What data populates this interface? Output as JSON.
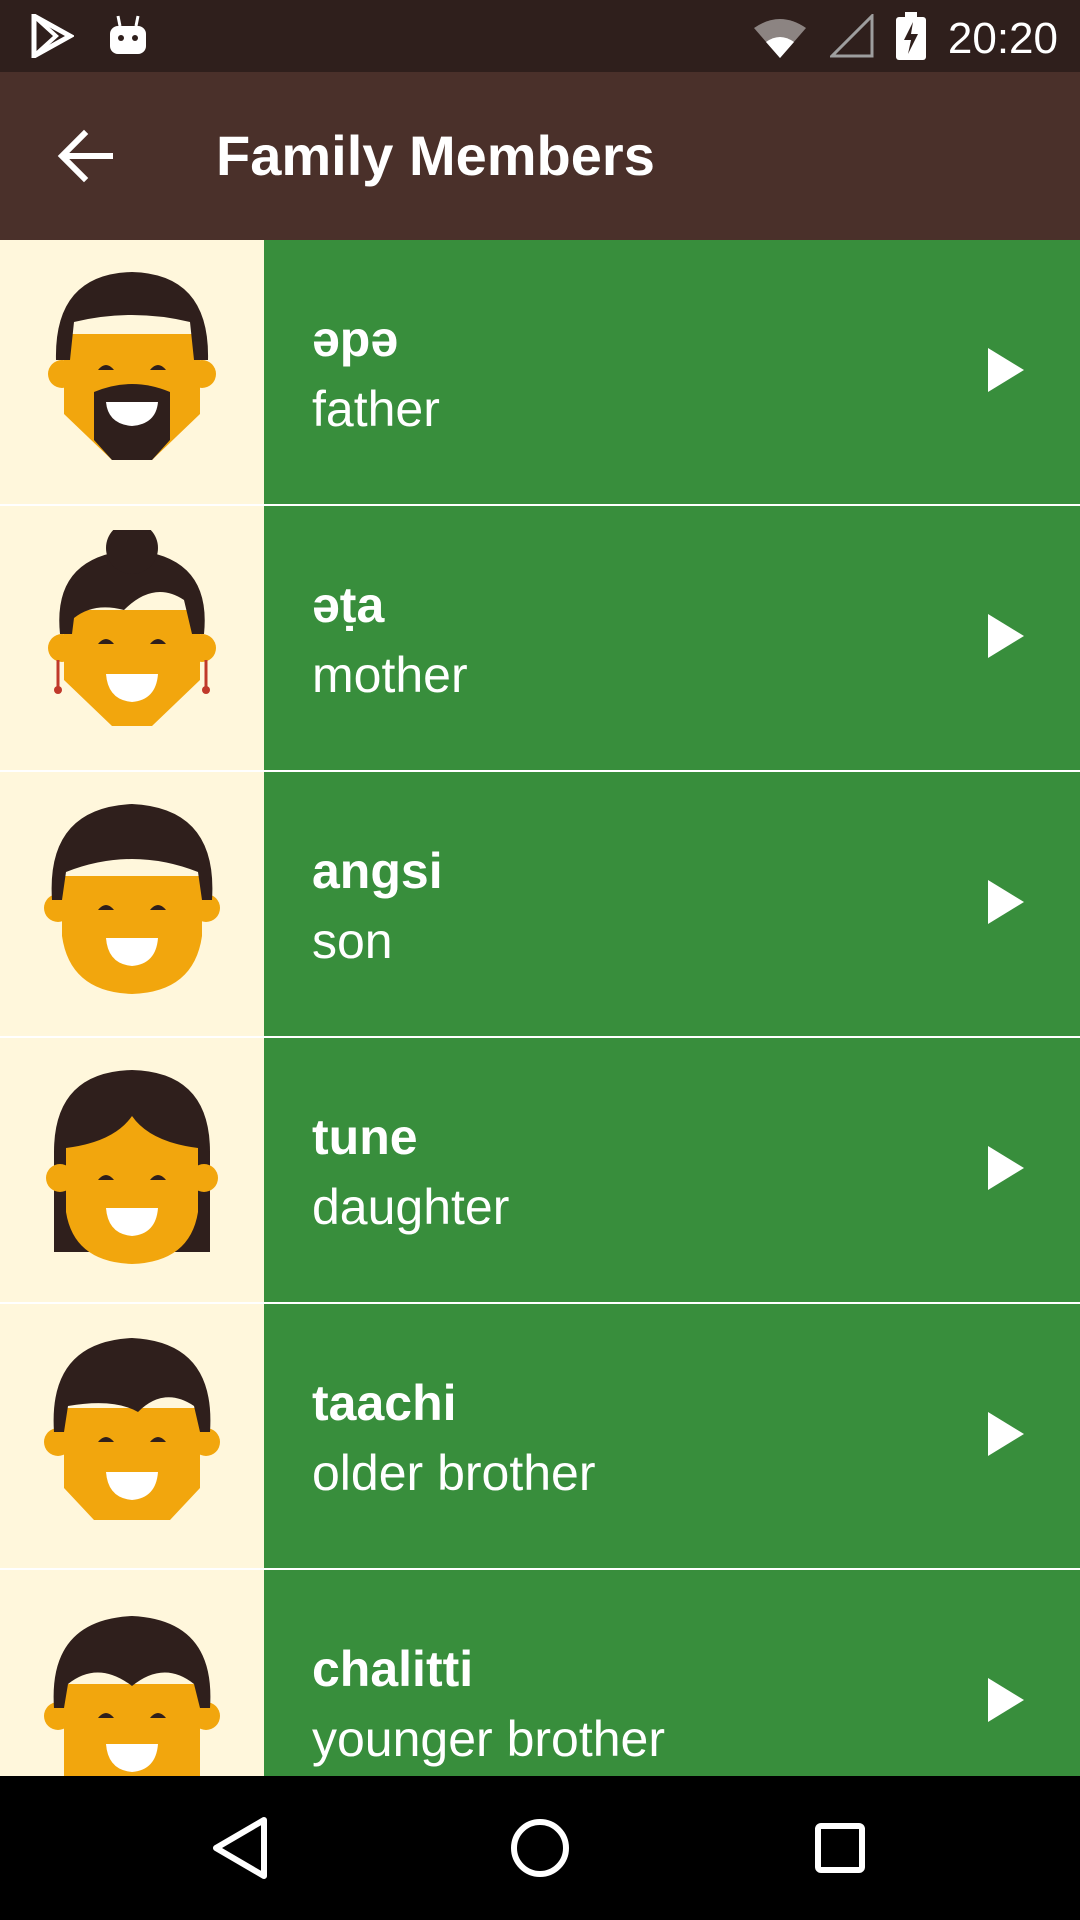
{
  "status_bar": {
    "time": "20:20",
    "icons": [
      "play-store-icon",
      "android-icon",
      "wifi-icon",
      "signal-icon",
      "battery-charging-icon"
    ]
  },
  "app_bar": {
    "title": "Family Members",
    "back_icon": "arrow-back-icon"
  },
  "items": [
    {
      "word": "əpə",
      "meaning": "father",
      "avatar": "father-avatar"
    },
    {
      "word": "əṭa",
      "meaning": "mother",
      "avatar": "mother-avatar"
    },
    {
      "word": "angsi",
      "meaning": "son",
      "avatar": "son-avatar"
    },
    {
      "word": "tune",
      "meaning": "daughter",
      "avatar": "daughter-avatar"
    },
    {
      "word": "taachi",
      "meaning": "older brother",
      "avatar": "older-brother-avatar"
    },
    {
      "word": "chalitti",
      "meaning": "younger brother",
      "avatar": "younger-brother-avatar"
    }
  ],
  "nav_bar": {
    "buttons": [
      "back-triangle-icon",
      "home-circle-icon",
      "recents-square-icon"
    ]
  },
  "colors": {
    "status_bar": "#2F1F1C",
    "app_bar": "#4A302A",
    "row": "#388E3C",
    "avatar_bg": "#FFF7DC",
    "skin": "#F2A60D",
    "hair": "#2F1F1C"
  }
}
